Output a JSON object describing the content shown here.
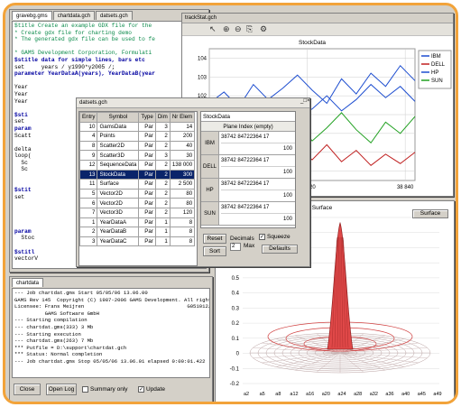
{
  "editor": {
    "tabs": [
      "gravebg.gms",
      "chartdata.gch",
      "datsets.gch"
    ],
    "lines": [
      {
        "t": "$title Create an example GDX file for the",
        "cls": "c"
      },
      {
        "t": "* Create gdx file for charting demo",
        "cls": "c"
      },
      {
        "t": "* The generated gdx file can be used to fe",
        "cls": "c"
      },
      {
        "t": "",
        "cls": ""
      },
      {
        "t": "* GAMS Development Corporation, Formulati",
        "cls": "c"
      },
      {
        "t": "$stitle data for simple lines, bars etc",
        "cls": "k"
      },
      {
        "t": "set     years / y1990*y2005 /;",
        "cls": ""
      },
      {
        "t": "parameter YearDataA(years), YearDataB(year",
        "cls": "k"
      },
      {
        "t": "",
        "cls": ""
      },
      {
        "t": "Year",
        "cls": ""
      },
      {
        "t": "Year",
        "cls": ""
      },
      {
        "t": "Year",
        "cls": ""
      },
      {
        "t": "",
        "cls": ""
      },
      {
        "t": "$sti",
        "cls": "k"
      },
      {
        "t": "set",
        "cls": ""
      },
      {
        "t": "param",
        "cls": "k"
      },
      {
        "t": "Scatt",
        "cls": ""
      },
      {
        "t": "",
        "cls": ""
      },
      {
        "t": "delta",
        "cls": ""
      },
      {
        "t": "loop(",
        "cls": ""
      },
      {
        "t": "  Sc",
        "cls": ""
      },
      {
        "t": "  Sc",
        "cls": ""
      },
      {
        "t": "",
        "cls": ""
      },
      {
        "t": "",
        "cls": ""
      },
      {
        "t": "$stit",
        "cls": "k"
      },
      {
        "t": "set",
        "cls": ""
      },
      {
        "t": "",
        "cls": ""
      },
      {
        "t": "",
        "cls": ""
      },
      {
        "t": "",
        "cls": ""
      },
      {
        "t": "",
        "cls": ""
      },
      {
        "t": "param",
        "cls": "k"
      },
      {
        "t": "  Stoc",
        "cls": ""
      },
      {
        "t": "",
        "cls": ""
      },
      {
        "t": "$stitl",
        "cls": "k"
      },
      {
        "t": "vectorV",
        "cls": ""
      }
    ]
  },
  "chartwin": {
    "title": "datsets.gch",
    "tab": "chartdata.gch",
    "headers": [
      "Entry",
      "Symbol",
      "Type",
      "Dim",
      "Nr Elem"
    ],
    "rows": [
      [
        "10",
        "GamsData",
        "Par",
        "3",
        "14"
      ],
      [
        "4",
        "Points",
        "Par",
        "2",
        "200"
      ],
      [
        "8",
        "Scatter2D",
        "Par",
        "2",
        "40"
      ],
      [
        "9",
        "Scatter3D",
        "Par",
        "3",
        "30"
      ],
      [
        "12",
        "SequenceData",
        "Par",
        "2",
        "138 000"
      ],
      [
        "13",
        "StockData",
        "Par",
        "2",
        "300"
      ],
      [
        "11",
        "Surface",
        "Par",
        "2",
        "2 500"
      ],
      [
        "5",
        "Vector2D",
        "Par",
        "2",
        "80"
      ],
      [
        "6",
        "Vector2D",
        "Par",
        "2",
        "80"
      ],
      [
        "7",
        "Vector3D",
        "Par",
        "2",
        "120"
      ],
      [
        "1",
        "YearDataA",
        "Par",
        "1",
        "8"
      ],
      [
        "2",
        "YearDataB",
        "Par",
        "1",
        "8"
      ],
      [
        "3",
        "YearDataC",
        "Par",
        "1",
        "8"
      ]
    ],
    "selected_row": 5
  },
  "datawin": {
    "title": "StockData",
    "plane": "Plane Index (empty)",
    "rows": [
      {
        "h": "IBM",
        "v": "38742 84722364 17",
        "n": "100"
      },
      {
        "h": "DELL",
        "v": "38742 84722364 17",
        "n": "100"
      },
      {
        "h": "HP",
        "v": "38742 84722364 17",
        "n": "100"
      },
      {
        "h": "SUN",
        "v": "38742 84722364 17",
        "n": "100"
      }
    ],
    "reset": "Reset",
    "sort": "Sort",
    "decimals_label": "Decimals",
    "decimals_value": "2",
    "max_label": "Max",
    "squeeze": "Squeeze",
    "indexes": "Defaults"
  },
  "linechart": {
    "title": "StockData",
    "window_title": "trackStat.gch",
    "toolbar_icons": [
      "pointer-icon",
      "zoom-in-icon",
      "zoom-out-icon",
      "copy-icon",
      "properties-icon"
    ],
    "legend": [
      {
        "name": "IBM",
        "color": "#1f4fd0"
      },
      {
        "name": "DELL",
        "color": "#c02020"
      },
      {
        "name": "HP",
        "color": "#1f4fd0"
      },
      {
        "name": "SUN",
        "color": "#20a020"
      }
    ]
  },
  "chart_data": [
    {
      "type": "line",
      "title": "StockData",
      "x": [
        38800,
        38803,
        38806,
        38809,
        38812,
        38815,
        38818,
        38821,
        38824,
        38827,
        38830,
        38833,
        38836,
        38839,
        38842
      ],
      "x_ticks": [
        "38 800",
        "38 820",
        "38 840"
      ],
      "y_ticks": [
        "104",
        "103",
        "102",
        "101",
        "100",
        "99",
        "98"
      ],
      "ylim": [
        97.5,
        104.5
      ],
      "series": [
        {
          "name": "IBM",
          "color": "#1f4fd0",
          "values": [
            100.1,
            100.6,
            101.2,
            100.4,
            100.8,
            101.6,
            100.9,
            101.3,
            102.0,
            101.2,
            101.8,
            102.6,
            101.9,
            102.5,
            101.7
          ]
        },
        {
          "name": "DELL",
          "color": "#c02020",
          "values": [
            99.3,
            98.8,
            99.5,
            98.4,
            99.0,
            98.3,
            99.2,
            98.6,
            99.4,
            98.5,
            99.1,
            98.3,
            98.9,
            98.4,
            99.0
          ]
        },
        {
          "name": "HP",
          "color": "#1f4fd0",
          "values": [
            101.6,
            102.2,
            101.4,
            102.6,
            101.8,
            102.4,
            103.1,
            102.3,
            101.6,
            102.9,
            102.1,
            103.2,
            102.5,
            103.6,
            102.8
          ]
        },
        {
          "name": "SUN",
          "color": "#20a020",
          "values": [
            100.4,
            101.0,
            100.2,
            99.8,
            100.9,
            101.7,
            100.6,
            99.6,
            100.3,
            101.1,
            100.2,
            99.5,
            100.6,
            100.0,
            100.9
          ]
        }
      ]
    },
    {
      "type": "surface",
      "title": "Surface",
      "z_ticks": [
        "0.9",
        "0.8",
        "0.7",
        "0.6",
        "0.5",
        "0.4",
        "0.3",
        "0.2",
        "0.1",
        "0",
        "-0.1",
        "-0.2"
      ],
      "x_ticks": [
        "a2",
        "a5",
        "a8",
        "a12",
        "a16",
        "a20",
        "a24",
        "a28",
        "a32",
        "a36",
        "a40",
        "a45",
        "a49"
      ]
    }
  ],
  "surfacewin": {
    "title": "Surface",
    "surface_button": "Surface"
  },
  "log": {
    "tab": "chartdata",
    "lines": [
      "--- Job chartdat.gms Start 05/05/06 13.06.00",
      "GAMS Rev 145  Copyright (C) 1987-2006 GAMS Development. All right",
      "Licensee: Frans Meijren                                  G051012/",
      "          GAMS Software GmbH",
      "--- Starting compilation",
      "--- chartdat.gms(333) 3 Mb",
      "--- Starting execution",
      "--- chartdat.gms(263) 7 Mb",
      "*** Putfile = D:\\support\\chartdat.gch",
      "*** Status: Normal completion",
      "--- Job chartdat.gms Stop 05/05/06 13.06.01 elapsed 0:00:01.422"
    ],
    "close": "Close",
    "open_log": "Open Log",
    "summary_only": "Summary only",
    "update": "Update"
  }
}
